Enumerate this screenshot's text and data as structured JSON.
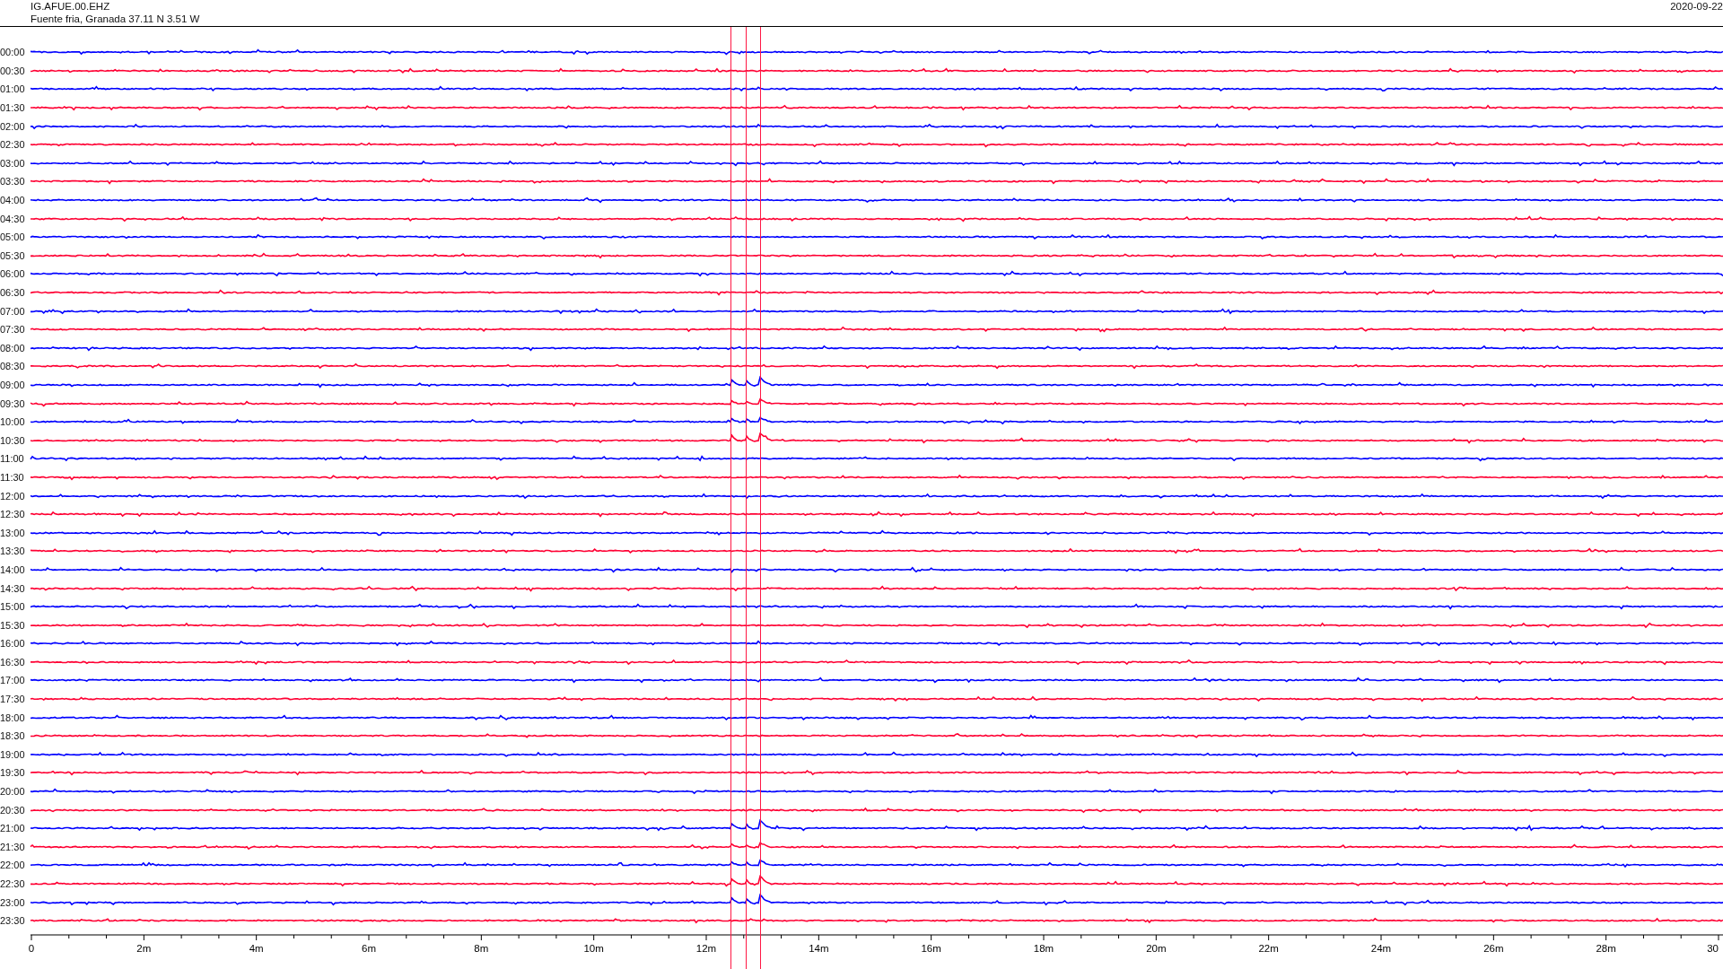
{
  "header": {
    "station": "IG.AFUE.00.EHZ",
    "location": "Fuente fria, Granada  37.11 N 3.51 W",
    "date": "2020-09-22"
  },
  "rows": [
    {
      "label": "00:00",
      "color": "#0000ff"
    },
    {
      "label": "00:30",
      "color": "#ff0033"
    },
    {
      "label": "01:00",
      "color": "#0000ff"
    },
    {
      "label": "01:30",
      "color": "#ff0033"
    },
    {
      "label": "02:00",
      "color": "#0000ff"
    },
    {
      "label": "02:30",
      "color": "#ff0033"
    },
    {
      "label": "03:00",
      "color": "#0000ff"
    },
    {
      "label": "03:30",
      "color": "#ff0033"
    },
    {
      "label": "04:00",
      "color": "#0000ff"
    },
    {
      "label": "04:30",
      "color": "#ff0033"
    },
    {
      "label": "05:00",
      "color": "#0000ff"
    },
    {
      "label": "05:30",
      "color": "#ff0033"
    },
    {
      "label": "06:00",
      "color": "#0000ff"
    },
    {
      "label": "06:30",
      "color": "#ff0033"
    },
    {
      "label": "07:00",
      "color": "#0000ff"
    },
    {
      "label": "07:30",
      "color": "#ff0033"
    },
    {
      "label": "08:00",
      "color": "#0000ff"
    },
    {
      "label": "08:30",
      "color": "#ff0033"
    },
    {
      "label": "09:00",
      "color": "#0000ff"
    },
    {
      "label": "09:30",
      "color": "#ff0033"
    },
    {
      "label": "10:00",
      "color": "#0000ff"
    },
    {
      "label": "10:30",
      "color": "#ff0033"
    },
    {
      "label": "11:00",
      "color": "#0000ff"
    },
    {
      "label": "11:30",
      "color": "#ff0033"
    },
    {
      "label": "12:00",
      "color": "#0000ff"
    },
    {
      "label": "12:30",
      "color": "#ff0033"
    },
    {
      "label": "13:00",
      "color": "#0000ff"
    },
    {
      "label": "13:30",
      "color": "#ff0033"
    },
    {
      "label": "14:00",
      "color": "#0000ff"
    },
    {
      "label": "14:30",
      "color": "#ff0033"
    },
    {
      "label": "15:00",
      "color": "#0000ff"
    },
    {
      "label": "15:30",
      "color": "#ff0033"
    },
    {
      "label": "16:00",
      "color": "#0000ff"
    },
    {
      "label": "16:30",
      "color": "#ff0033"
    },
    {
      "label": "17:00",
      "color": "#0000ff"
    },
    {
      "label": "17:30",
      "color": "#ff0033"
    },
    {
      "label": "18:00",
      "color": "#0000ff"
    },
    {
      "label": "18:30",
      "color": "#ff0033"
    },
    {
      "label": "19:00",
      "color": "#0000ff"
    },
    {
      "label": "19:30",
      "color": "#ff0033"
    },
    {
      "label": "20:00",
      "color": "#0000ff"
    },
    {
      "label": "20:30",
      "color": "#ff0033"
    },
    {
      "label": "21:00",
      "color": "#0000ff"
    },
    {
      "label": "21:30",
      "color": "#ff0033"
    },
    {
      "label": "22:00",
      "color": "#0000ff"
    },
    {
      "label": "22:30",
      "color": "#ff0033"
    },
    {
      "label": "23:00",
      "color": "#0000ff"
    },
    {
      "label": "23:30",
      "color": "#ff0033"
    }
  ],
  "x_axis": {
    "labels": [
      "0",
      "2m",
      "4m",
      "6m",
      "8m",
      "10m",
      "12m",
      "14m",
      "16m",
      "18m",
      "20m",
      "22m",
      "24m",
      "26m",
      "28m",
      "30"
    ]
  }
}
